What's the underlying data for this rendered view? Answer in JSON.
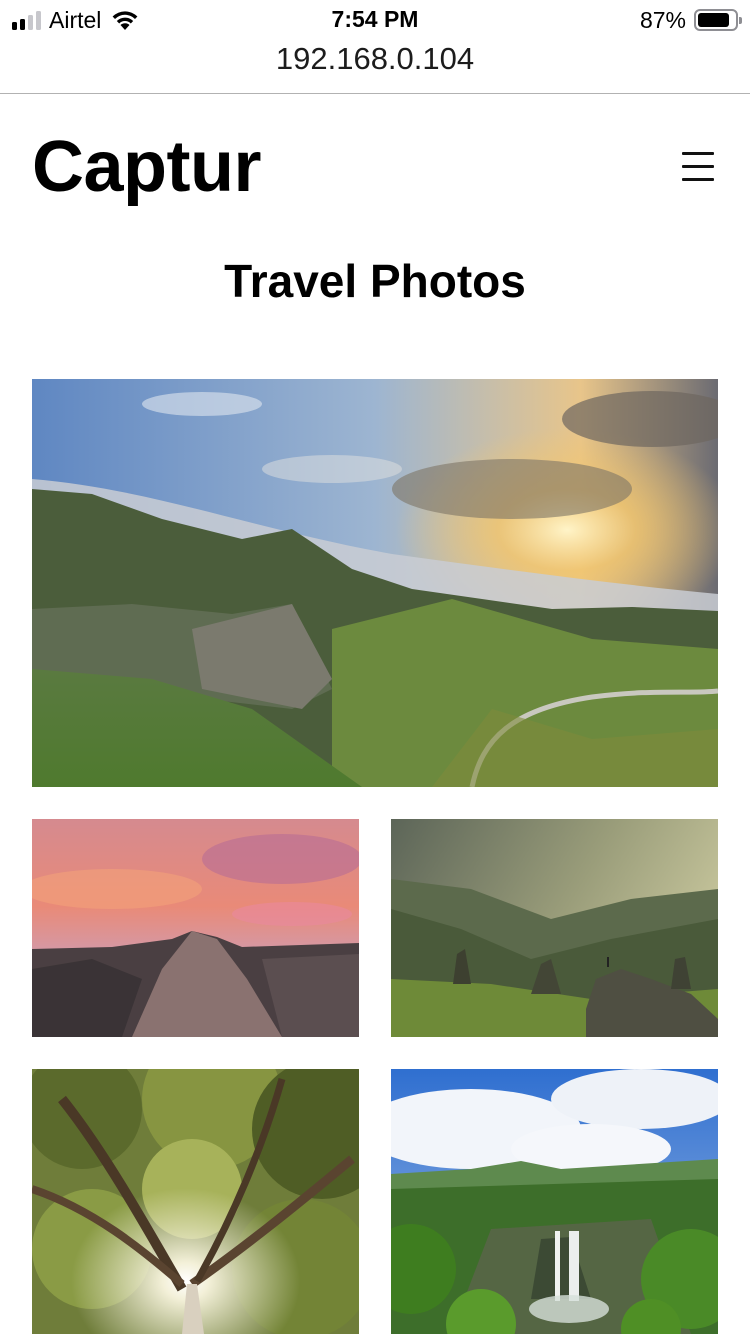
{
  "status_bar": {
    "carrier": "Airtel",
    "time": "7:54 PM",
    "battery_percent": "87%",
    "battery_level": 0.87,
    "signal_bars_active": 2,
    "signal_bars_total": 4,
    "icons": [
      "signal-icon",
      "wifi-icon",
      "battery-icon"
    ]
  },
  "browser": {
    "url": "192.168.0.104"
  },
  "site": {
    "logo": "Captur",
    "menu_icon": "hamburger-menu-icon"
  },
  "page": {
    "title": "Travel Photos"
  },
  "photos": [
    {
      "subject": "misty green valley with winding road at sunset"
    },
    {
      "subject": "pink sunset sky over granite dome mountain"
    },
    {
      "subject": "hiker on rock in green foggy mountains"
    },
    {
      "subject": "looking up into tree canopy with sunburst"
    },
    {
      "subject": "waterfall in lush green jungle under blue sky"
    }
  ],
  "colors": {
    "text": "#000000",
    "background": "#ffffff",
    "divider": "#b2b2b2"
  }
}
